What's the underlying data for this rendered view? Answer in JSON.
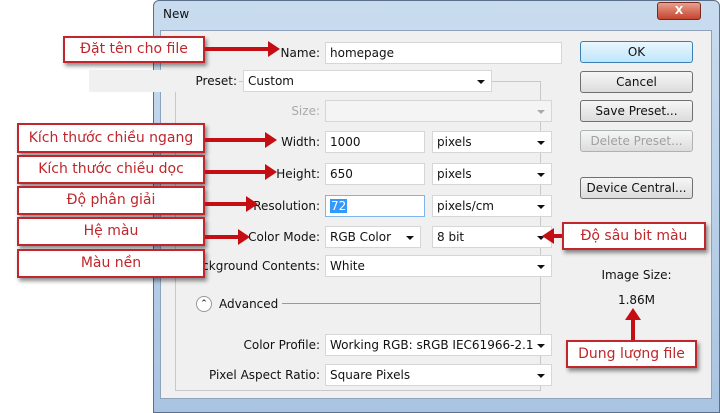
{
  "window": {
    "title": "New",
    "close_label": "X"
  },
  "form": {
    "name": {
      "label": "Name:",
      "value": "homepage"
    },
    "preset": {
      "label": "Preset:",
      "value": "Custom"
    },
    "size": {
      "label": "Size:",
      "value": ""
    },
    "width": {
      "label": "Width:",
      "value": "1000",
      "unit": "pixels"
    },
    "height": {
      "label": "Height:",
      "value": "650",
      "unit": "pixels"
    },
    "resolution": {
      "label": "Resolution:",
      "value": "72",
      "unit": "pixels/cm"
    },
    "color_mode": {
      "label": "Color Mode:",
      "value": "RGB Color",
      "bits": "8 bit"
    },
    "background": {
      "label": "Background Contents:",
      "value": "White"
    },
    "advanced": {
      "label": "Advanced"
    },
    "color_profile": {
      "label": "Color Profile:",
      "value": "Working RGB:  sRGB IEC61966-2.1"
    },
    "pixel_aspect": {
      "label": "Pixel Aspect Ratio:",
      "value": "Square Pixels"
    }
  },
  "buttons": {
    "ok": "OK",
    "cancel": "Cancel",
    "save_preset": "Save Preset...",
    "delete_preset": "Delete Preset...",
    "device_central": "Device Central..."
  },
  "image_size": {
    "label": "Image Size:",
    "value": "1.86M"
  },
  "callouts": {
    "name": "Đặt tên cho file",
    "width": "Kích thước chiều ngang",
    "height": "Kích thước chiều dọc",
    "resolution": "Độ phân giải",
    "color_mode": "Hệ màu",
    "background": "Màu nền",
    "bit_depth": "Độ sâu bit màu",
    "file_size": "Dung lượng file"
  },
  "colors": {
    "callout": "#c0262b",
    "arrow": "#c40e14",
    "selection": "#3399ff"
  }
}
